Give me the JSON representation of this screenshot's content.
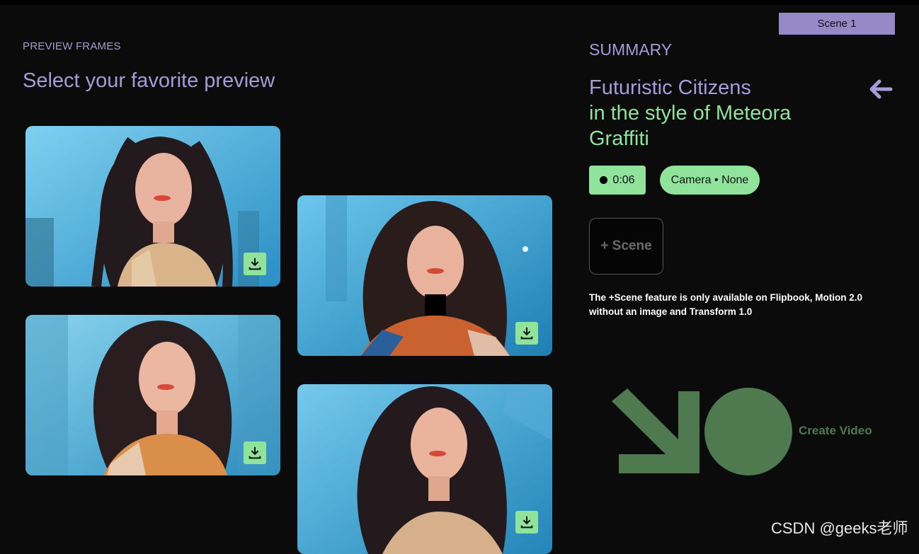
{
  "header": {
    "scene_tab": "Scene 1"
  },
  "preview": {
    "eyebrow": "PREVIEW FRAMES",
    "headline": "Select your favorite preview",
    "frames": [
      {
        "name": "preview-frame-1",
        "download_icon": "download-icon"
      },
      {
        "name": "preview-frame-2",
        "download_icon": "download-icon"
      },
      {
        "name": "preview-frame-3",
        "download_icon": "download-icon"
      },
      {
        "name": "preview-frame-4",
        "download_icon": "download-icon"
      }
    ]
  },
  "summary": {
    "label": "SUMMARY",
    "subject": "Futuristic Citizens",
    "style_line1": "in the style of Meteora",
    "style_line2": "Graffiti",
    "back_icon": "arrow-left-icon",
    "duration": "0:06",
    "camera": "Camera • None",
    "add_scene": "+ Scene",
    "note": "The +Scene feature is only available on Flipbook, Motion 2.0 without an image and Transform 1.0"
  },
  "create": {
    "label": "Create Video",
    "icon": "arrow-down-right-icon"
  },
  "watermark": "CSDN @geeks老师",
  "colors": {
    "accent_purple": "#a79bd9",
    "accent_green": "#8fe39a",
    "create_green": "#4f7a50",
    "background": "#0b0b0b"
  }
}
